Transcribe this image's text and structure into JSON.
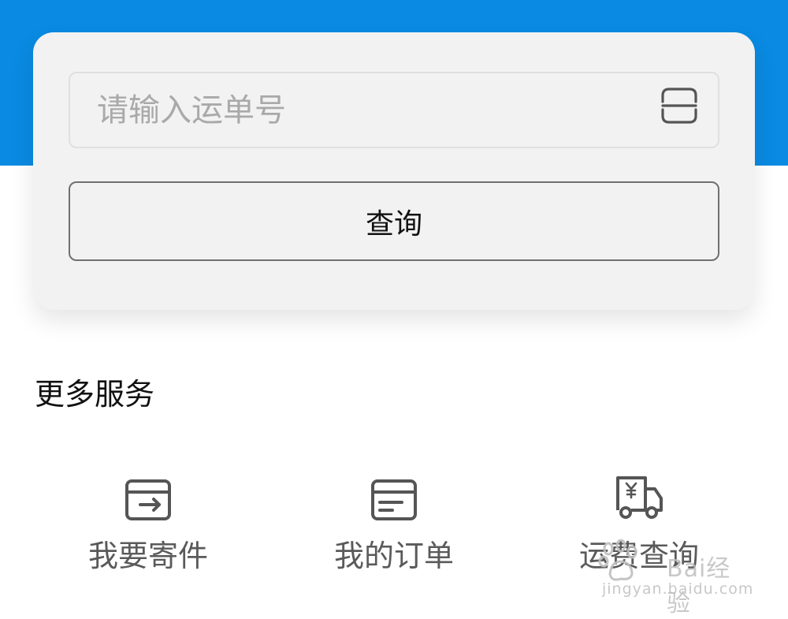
{
  "search": {
    "placeholder": "请输入运单号",
    "value": ""
  },
  "actions": {
    "query_label": "查询"
  },
  "section": {
    "title": "更多服务"
  },
  "services": [
    {
      "label": "我要寄件",
      "icon": "send-package-icon"
    },
    {
      "label": "我的订单",
      "icon": "order-box-icon"
    },
    {
      "label": "运费查询",
      "icon": "freight-truck-icon"
    }
  ],
  "watermark": {
    "text": "Bai经验",
    "url": "jingyan.baidu.com"
  },
  "colors": {
    "header_blue": "#0a8ae2",
    "card_bg": "#f2f2f2",
    "icon_gray": "#555555"
  }
}
